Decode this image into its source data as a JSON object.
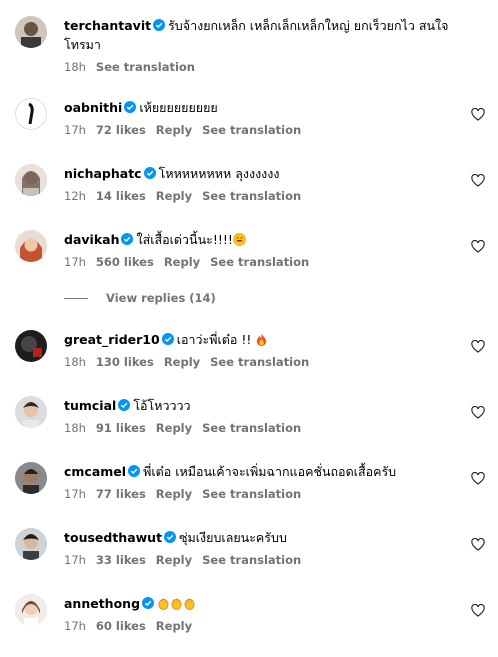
{
  "comments": [
    {
      "user": "terchantavit",
      "verified": true,
      "text": "รับจ้างยกเหล็ก เหล็กเล็กเหล็กใหญ่ ยกเร็วยกไว สนใจโทรมา",
      "time": "18h",
      "likes": "",
      "reply": "",
      "translate": "See translation",
      "heart": false
    },
    {
      "user": "oabnithi",
      "verified": true,
      "text": "เห้ยยยยยยยยย",
      "time": "17h",
      "likes": "72 likes",
      "reply": "Reply",
      "translate": "See translation",
      "heart": true
    },
    {
      "user": "nichaphatc",
      "verified": true,
      "text": "โหหหหหหหห ลุงงงงงง",
      "time": "12h",
      "likes": "14 likes",
      "reply": "Reply",
      "translate": "See translation",
      "heart": true
    },
    {
      "user": "davikah",
      "verified": true,
      "text": "ใส่เสื้อเด่วนี้นะ!!!!",
      "emoji": "smile",
      "time": "17h",
      "likes": "560 likes",
      "reply": "Reply",
      "translate": "See translation",
      "heart": true
    },
    {
      "user": "great_rider10",
      "verified": true,
      "text": "เอาว่ะพี่เต๋อ !! ",
      "emoji": "fire",
      "time": "18h",
      "likes": "130 likes",
      "reply": "Reply",
      "translate": "See translation",
      "heart": true
    },
    {
      "user": "tumcial",
      "verified": true,
      "text": "โอ้โหวววว",
      "time": "18h",
      "likes": "91 likes",
      "reply": "Reply",
      "translate": "See translation",
      "heart": true
    },
    {
      "user": "cmcamel",
      "verified": true,
      "text": "พี่เต๋อ เหมือนเค้าจะเพิ่มฉากแอคชั่นถอดเสื้อครับ",
      "time": "17h",
      "likes": "77 likes",
      "reply": "Reply",
      "translate": "See translation",
      "heart": true
    },
    {
      "user": "tousedthawut",
      "verified": true,
      "text": "ซุ่มเงียบเลยนะครับบ",
      "time": "17h",
      "likes": "33 likes",
      "reply": "Reply",
      "translate": "See translation",
      "heart": true
    },
    {
      "user": "annethong",
      "verified": true,
      "text": "",
      "emoji": "clap3",
      "time": "17h",
      "likes": "60 likes",
      "reply": "Reply",
      "translate": "",
      "heart": true
    }
  ],
  "view_replies": "View replies (14)",
  "colors": {
    "verified": "#0095f6",
    "meta": "#737373"
  }
}
